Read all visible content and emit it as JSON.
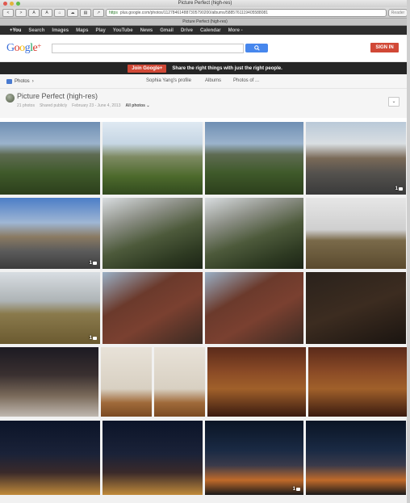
{
  "browser": {
    "window_title": "Picture Perfect (high-res)",
    "tab_title": "Picture Perfect (high-res)",
    "url_scheme": "https",
    "url": "plus.google.com/photos/112784614887305790200/albums/5885761119405588081",
    "reader_label": "Reader",
    "toolbar_buttons": [
      "<",
      ">",
      "A",
      "A"
    ]
  },
  "google_bar": {
    "items": [
      "+You",
      "Search",
      "Images",
      "Maps",
      "Play",
      "YouTube",
      "News",
      "Gmail",
      "Drive",
      "Calendar",
      "More -"
    ]
  },
  "header": {
    "logo_text": "Google+",
    "search_placeholder": "",
    "search_button_icon": "search-icon",
    "signin_label": "SIGN IN"
  },
  "promo": {
    "button_label": "Join Google+",
    "text": "Share the right things with just the right people."
  },
  "subnav": {
    "photos_label": "Photos",
    "links": [
      "Sophia Yang's profile",
      "Albums",
      "Photos of ..."
    ]
  },
  "album": {
    "title": "Picture Perfect (high-res)",
    "photo_count": "21 photos",
    "sharing": "Shared publicly",
    "date_range": "February 23 - June 4, 2013",
    "filter": "All photos",
    "filter_icon": "chevron-down-icon",
    "collapse_icon": "chevron-down-icon"
  },
  "photos": [
    {
      "scene": "landscape-valley",
      "comments": ""
    },
    {
      "scene": "landscape-bright",
      "comments": ""
    },
    {
      "scene": "landscape-valley",
      "comments": ""
    },
    {
      "scene": "street-car",
      "comments": "1"
    },
    {
      "scene": "street-car-2",
      "comments": "1"
    },
    {
      "scene": "rocky-coast",
      "comments": ""
    },
    {
      "scene": "rocky-coast",
      "comments": ""
    },
    {
      "scene": "tree-field-dog",
      "comments": ""
    },
    {
      "scene": "hill-dog",
      "comments": "1"
    },
    {
      "scene": "brick-building",
      "comments": ""
    },
    {
      "scene": "brick-building",
      "comments": ""
    },
    {
      "scene": "dark-room",
      "comments": ""
    },
    {
      "scene": "party-woman",
      "comments": ""
    },
    {
      "scene": "door-cat",
      "comments": ""
    },
    {
      "scene": "door-cat",
      "comments": ""
    },
    {
      "scene": "library-piano",
      "comments": ""
    },
    {
      "scene": "library-piano",
      "comments": ""
    },
    {
      "scene": "group-night",
      "comments": ""
    },
    {
      "scene": "group-night",
      "comments": ""
    },
    {
      "scene": "city-night",
      "comments": "1"
    },
    {
      "scene": "city-night",
      "comments": ""
    }
  ],
  "colors": {
    "accent_red": "#d14836",
    "search_blue": "#4787ed",
    "bar_dark": "#2d2d2d"
  }
}
